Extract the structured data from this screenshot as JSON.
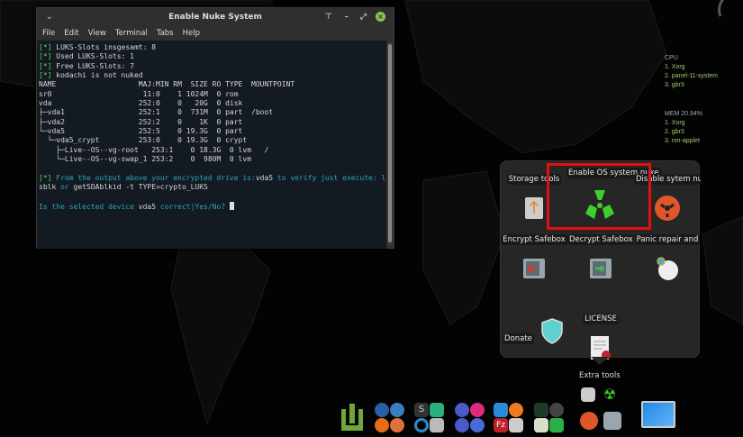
{
  "window": {
    "title": "Enable Nuke System",
    "menu": [
      "File",
      "Edit",
      "View",
      "Terminal",
      "Tabs",
      "Help"
    ]
  },
  "terminal": {
    "lines": [
      [
        {
          "t": "[*]",
          "c": "g"
        },
        {
          "t": " LUKS-Slots insgesamt: 8",
          "c": "w"
        }
      ],
      [
        {
          "t": "[*]",
          "c": "g"
        },
        {
          "t": " Used LUKS-Slots: 1",
          "c": "w"
        }
      ],
      [
        {
          "t": "[*]",
          "c": "g"
        },
        {
          "t": " Free LUKS-Slots: 7",
          "c": "w"
        }
      ],
      [
        {
          "t": "[*]",
          "c": "g"
        },
        {
          "t": " kodachi is not nuked",
          "c": "w"
        }
      ],
      [
        {
          "t": "NAME                   MAJ:MIN RM  SIZE RO TYPE  MOUNTPOINT",
          "c": "w"
        }
      ],
      [
        {
          "t": "sr0                     11:0    1 1024M  0 rom",
          "c": "w"
        }
      ],
      [
        {
          "t": "vda                    252:0    0   20G  0 disk",
          "c": "w"
        }
      ],
      [
        {
          "t": "├─vda1                 252:1    0  731M  0 part  /boot",
          "c": "w"
        }
      ],
      [
        {
          "t": "├─vda2                 252:2    0    1K  0 part",
          "c": "w"
        }
      ],
      [
        {
          "t": "└─vda5                 252:5    0 19.3G  0 part",
          "c": "w"
        }
      ],
      [
        {
          "t": "  └─vda5_crypt         253:0    0 19.3G  0 crypt",
          "c": "w"
        }
      ],
      [
        {
          "t": "    ├─Live--OS--vg-root   253:1    0 18.3G  0 lvm   /",
          "c": "w"
        }
      ],
      [
        {
          "t": "    └─Live--OS--vg-swap_1 253:2    0  980M  0 lvm",
          "c": "w"
        }
      ],
      [
        {
          "t": " ",
          "c": "w"
        }
      ],
      [
        {
          "t": "[*]",
          "c": "g"
        },
        {
          "t": " From the output above your encrypted drive is:",
          "c": "c"
        },
        {
          "t": "vda5",
          "c": "w"
        },
        {
          "t": " to verify just execute: l",
          "c": "c"
        }
      ],
      [
        {
          "t": "sblk ",
          "c": "w"
        },
        {
          "t": "or",
          "c": "c"
        },
        {
          "t": " getSDAblkid -t TYPE=crypto_LUKS",
          "c": "w"
        }
      ],
      [
        {
          "t": " ",
          "c": "w"
        }
      ],
      [
        {
          "t": "Is the selected device ",
          "c": "c"
        },
        {
          "t": "vda5",
          "c": "w"
        },
        {
          "t": " correct|Yes/No? ",
          "c": "c"
        }
      ]
    ]
  },
  "popup": {
    "items": [
      {
        "label": "Storage tools",
        "icon": "usb-drive-icon"
      },
      {
        "label": "Enable OS system nuke",
        "icon": "radiation-icon"
      },
      {
        "label": "Disable sytem nuke",
        "icon": "nuke-disable-icon"
      },
      {
        "label": "Encrypt Safebox",
        "icon": "safe-encrypt-icon"
      },
      {
        "label": "Decrypt Safebox",
        "icon": "safe-decrypt-icon"
      },
      {
        "label": "Panic repair and",
        "icon": "panic-repair-icon"
      },
      {
        "label": "Donate",
        "icon": "shield-icon"
      },
      {
        "label": "LICENSE",
        "icon": "certificate-icon"
      }
    ]
  },
  "dock": {
    "extra_label": "Extra tools"
  },
  "conky": {
    "cpu_title": "CPU",
    "cpu": [
      "1. Xorg",
      "2. panel-11-system",
      "3. gbr3"
    ],
    "mem_title": "MEM 20.94%",
    "mem": [
      "1. Xorg",
      "2. gbr3",
      "3. nm-applet"
    ]
  },
  "colors": {
    "g": "#58d858",
    "w": "#d6d6d6",
    "c": "#2aa6b8",
    "highlight": "#e01010"
  }
}
